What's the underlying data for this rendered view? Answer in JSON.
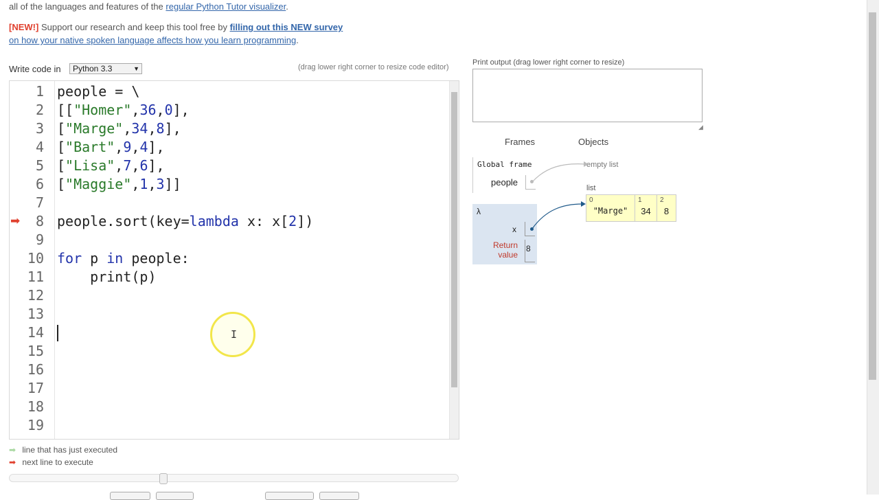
{
  "header": {
    "intro_text": "all of the languages and features of the",
    "intro_link": "regular Python Tutor visualizer",
    "intro_end": ".",
    "new_tag": "[NEW!]",
    "survey_text": "Support our research and keep this tool free by",
    "survey_link": "filling out this NEW survey",
    "survey_link2": "on how your native spoken language affects how you learn programming",
    "survey_end": "."
  },
  "editor_bar": {
    "write_code_label": "Write code in",
    "language": "Python 3.3",
    "drag_hint": "(drag lower right corner to resize code editor)"
  },
  "editor": {
    "lines": [
      {
        "n": "1",
        "parts": [
          [
            "t",
            "people = \\"
          ]
        ]
      },
      {
        "n": "2",
        "parts": [
          [
            "t",
            "[["
          ],
          [
            "s",
            "\"Homer\""
          ],
          [
            "t",
            ","
          ],
          [
            "n",
            "36"
          ],
          [
            "t",
            ","
          ],
          [
            "n",
            "0"
          ],
          [
            "t",
            "],"
          ]
        ]
      },
      {
        "n": "3",
        "parts": [
          [
            "t",
            "["
          ],
          [
            "s",
            "\"Marge\""
          ],
          [
            "t",
            ","
          ],
          [
            "n",
            "34"
          ],
          [
            "t",
            ","
          ],
          [
            "n",
            "8"
          ],
          [
            "t",
            "],"
          ]
        ]
      },
      {
        "n": "4",
        "parts": [
          [
            "t",
            "["
          ],
          [
            "s",
            "\"Bart\""
          ],
          [
            "t",
            ","
          ],
          [
            "n",
            "9"
          ],
          [
            "t",
            ","
          ],
          [
            "n",
            "4"
          ],
          [
            "t",
            "],"
          ]
        ]
      },
      {
        "n": "5",
        "parts": [
          [
            "t",
            "["
          ],
          [
            "s",
            "\"Lisa\""
          ],
          [
            "t",
            ","
          ],
          [
            "n",
            "7"
          ],
          [
            "t",
            ","
          ],
          [
            "n",
            "6"
          ],
          [
            "t",
            "],"
          ]
        ]
      },
      {
        "n": "6",
        "parts": [
          [
            "t",
            "["
          ],
          [
            "s",
            "\"Maggie\""
          ],
          [
            "t",
            ","
          ],
          [
            "n",
            "1"
          ],
          [
            "t",
            ","
          ],
          [
            "n",
            "3"
          ],
          [
            "t",
            "]]"
          ]
        ]
      },
      {
        "n": "7",
        "parts": []
      },
      {
        "n": "8",
        "parts": [
          [
            "t",
            "people.sort(key="
          ],
          [
            "k",
            "lambda"
          ],
          [
            "t",
            " x: x["
          ],
          [
            "n",
            "2"
          ],
          [
            "t",
            "])"
          ]
        ]
      },
      {
        "n": "9",
        "parts": []
      },
      {
        "n": "10",
        "parts": [
          [
            "k",
            "for"
          ],
          [
            "t",
            " p "
          ],
          [
            "k",
            "in"
          ],
          [
            "t",
            " people:"
          ]
        ]
      },
      {
        "n": "11",
        "parts": [
          [
            "t",
            "    print(p)"
          ]
        ]
      },
      {
        "n": "12",
        "parts": []
      },
      {
        "n": "13",
        "parts": []
      },
      {
        "n": "14",
        "parts": []
      },
      {
        "n": "15",
        "parts": []
      },
      {
        "n": "16",
        "parts": []
      },
      {
        "n": "17",
        "parts": []
      },
      {
        "n": "18",
        "parts": []
      },
      {
        "n": "19",
        "parts": []
      }
    ],
    "exec_arrow_line": "8",
    "exec_arrow_glyph": "➡"
  },
  "legend": {
    "just_executed_glyph": "➡",
    "just_executed": "line that has just executed",
    "next_line_glyph": "➡",
    "next_line": "next line to execute"
  },
  "output": {
    "print_label": "Print output (drag lower right corner to resize)",
    "resize_glyph": "◢"
  },
  "viz": {
    "frames_header": "Frames",
    "objects_header": "Objects",
    "global_frame_title": "Global frame",
    "global_var": "people",
    "lambda_title": "λ",
    "lambda_var": "x",
    "return_label": "Return value",
    "return_value": "8",
    "empty_list": "empty list",
    "list_label": "list",
    "list_items": [
      {
        "idx": "0",
        "val": "\"Marge\""
      },
      {
        "idx": "1",
        "val": "34"
      },
      {
        "idx": "2",
        "val": "8"
      }
    ]
  },
  "colors": {
    "exec_arrow": "#e0402e",
    "just_executed_arrow": "#a8d8a0",
    "frame_highlight": "#dbe5f1",
    "list_bg": "#ffffc6",
    "pointer": "#1f5a8a"
  },
  "cursor_glyph": "I"
}
